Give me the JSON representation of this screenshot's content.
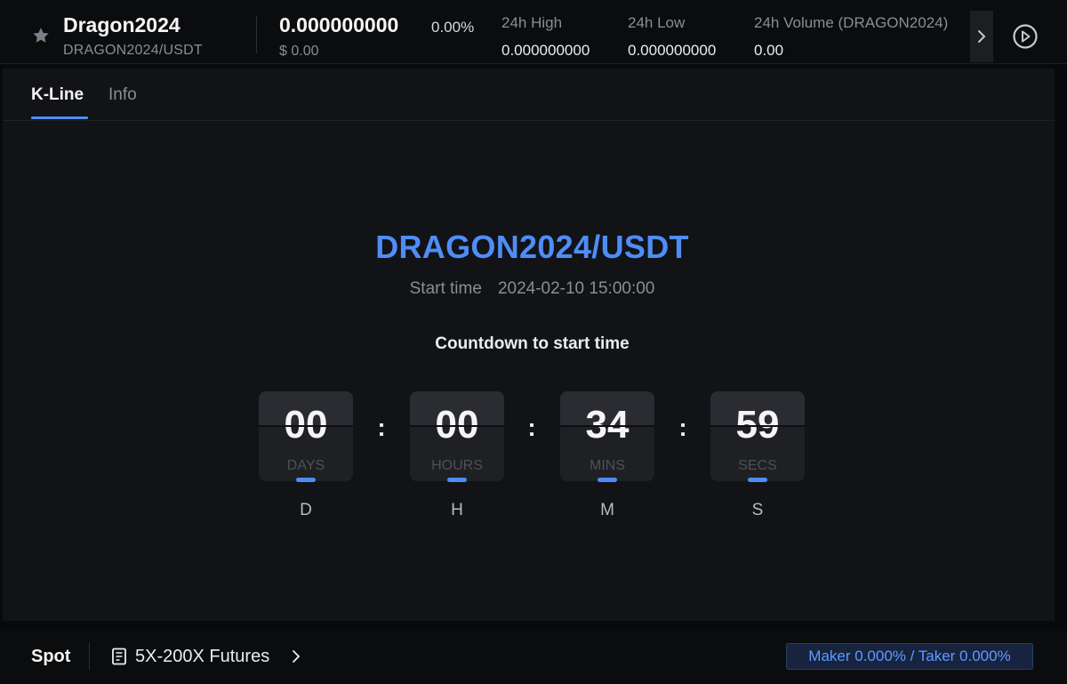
{
  "header": {
    "symbol": "Dragon2024",
    "pair": "DRAGON2024/USDT",
    "price": "0.000000000",
    "change": "0.00%",
    "usd_price": "$ 0.00",
    "stats": [
      {
        "label": "24h High",
        "value": "0.000000000"
      },
      {
        "label": "24h Low",
        "value": "0.000000000"
      },
      {
        "label": "24h Volume (DRAGON2024)",
        "value": "0.00"
      }
    ],
    "icons": {
      "favorite": "star-icon",
      "scroll": "chevron-right-icon",
      "play": "play-circle-icon"
    }
  },
  "tabs": [
    {
      "label": "K-Line",
      "active": true
    },
    {
      "label": "Info",
      "active": false
    }
  ],
  "listing": {
    "pair": "DRAGON2024/USDT",
    "start_label": "Start time",
    "start_time": "2024-02-10 15:00:00",
    "countdown_title": "Countdown to start time",
    "units": [
      {
        "value": "00",
        "unit": "DAYS",
        "letter": "D"
      },
      {
        "value": "00",
        "unit": "HOURS",
        "letter": "H"
      },
      {
        "value": "34",
        "unit": "MINS",
        "letter": "M"
      },
      {
        "value": "59",
        "unit": "SECS",
        "letter": "S"
      }
    ],
    "separator": ":"
  },
  "footer": {
    "spot": "Spot",
    "futures": "5X-200X Futures",
    "fees": "Maker 0.000% / Taker 0.000%"
  },
  "colors": {
    "accent": "#4f8df6",
    "background": "#08090b",
    "panel": "#121317"
  }
}
